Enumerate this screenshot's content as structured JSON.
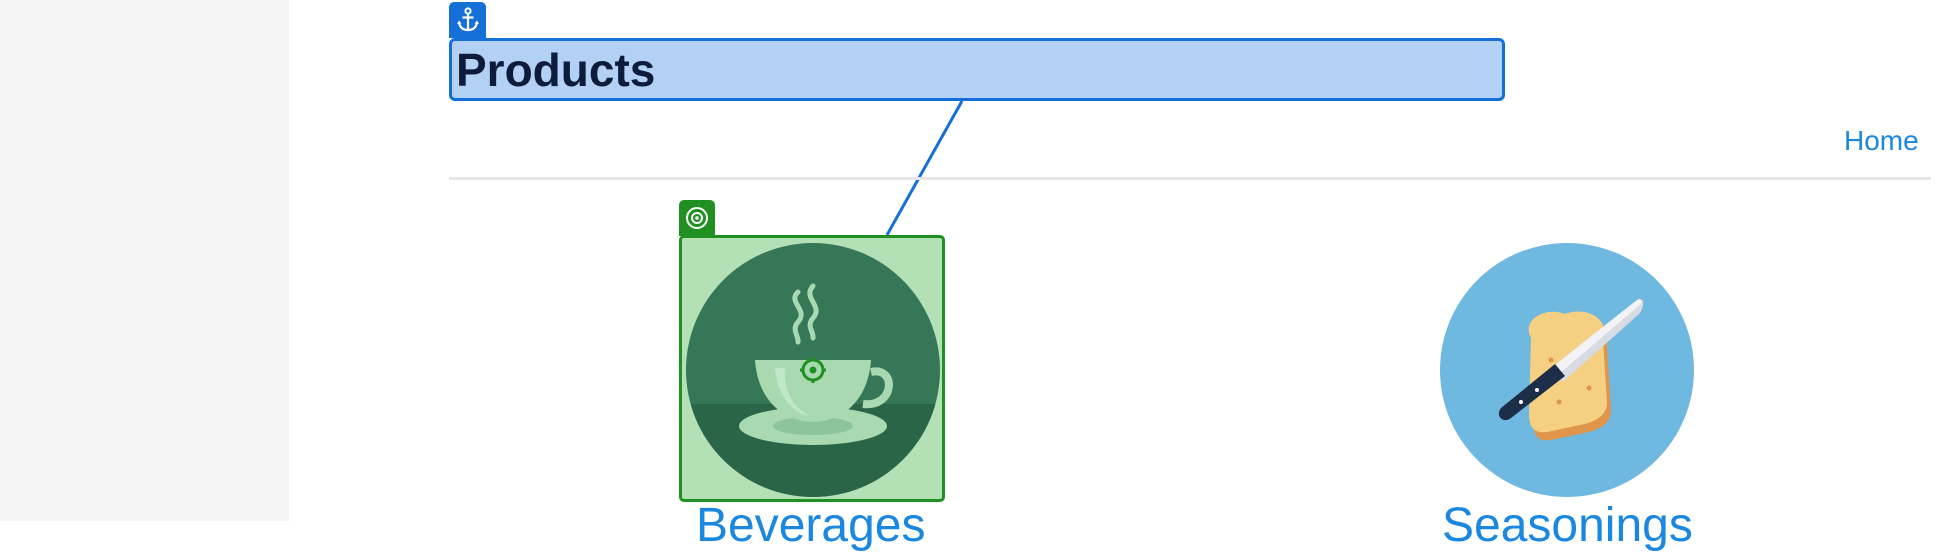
{
  "page": {
    "title": "Products"
  },
  "nav": {
    "home_label": "Home"
  },
  "products": [
    {
      "label": "Beverages",
      "image_icon": "coffee-cup-icon"
    },
    {
      "label": "Seasonings",
      "image_icon": "bread-knife-icon"
    }
  ],
  "annotations": {
    "anchor_icon": "anchor-icon",
    "target_icon": "target-icon",
    "anchor_color": "#1470d6",
    "target_color": "#1f9021"
  },
  "colors": {
    "link": "#1a87e0",
    "title_highlight": "#b3d1f5",
    "target_highlight": "#b3e0b5",
    "beverages_bg": "#347552",
    "seasonings_bg": "#6fb8e0"
  }
}
